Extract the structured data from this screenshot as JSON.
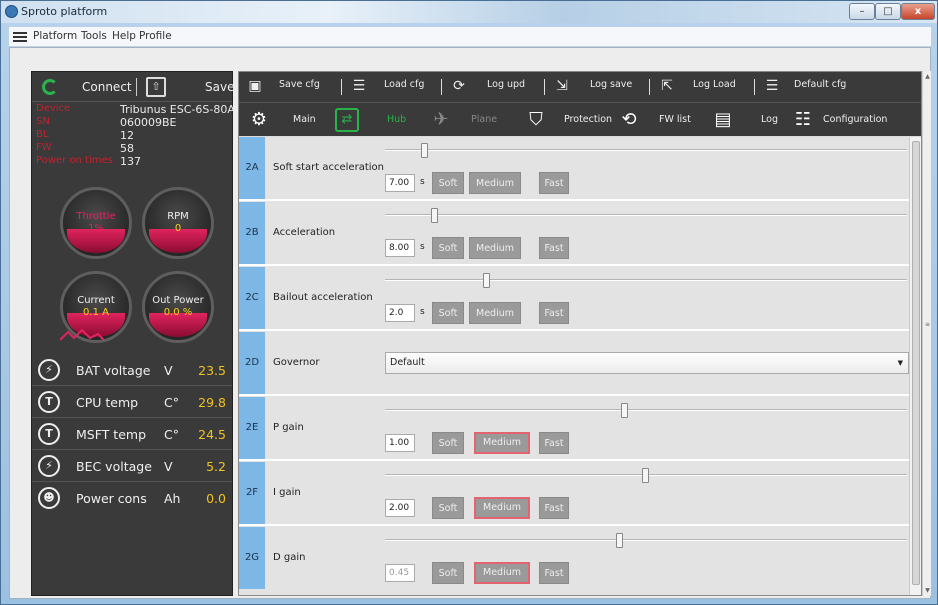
{
  "window": {
    "title": "Sproto platform",
    "controls": {
      "min": "–",
      "max": "□",
      "close": "x"
    }
  },
  "menu": [
    "Platform",
    "Tools",
    "Help",
    "Profile"
  ],
  "left_panel": {
    "connect_label": "Connect",
    "save_label": "Save",
    "info": [
      {
        "key": "Device",
        "value": "Tribunus ESC-6S-80A"
      },
      {
        "key": "SN",
        "value": "060009BE"
      },
      {
        "key": "BL",
        "value": "12"
      },
      {
        "key": "FW",
        "value": "58"
      },
      {
        "key": "Power on times",
        "value": "137"
      }
    ],
    "gauges": {
      "throttle": {
        "name": "Throttle",
        "value": "1%"
      },
      "rpm": {
        "name": "RPM",
        "value": "0"
      },
      "current": {
        "name": "Current",
        "value": "0.1 A"
      },
      "out_power": {
        "name": "Out Power",
        "value": "0.0 %"
      }
    },
    "stats": [
      {
        "icon": "bat-voltage-icon",
        "symbol": "⚡",
        "label": "BAT voltage",
        "unit": "V",
        "value": "23.5"
      },
      {
        "icon": "cpu-temp-icon",
        "symbol": "T",
        "label": "CPU temp",
        "unit": "C°",
        "value": "29.8"
      },
      {
        "icon": "msft-temp-icon",
        "symbol": "T",
        "label": "MSFT temp",
        "unit": "C°",
        "value": "24.5"
      },
      {
        "icon": "bec-voltage-icon",
        "symbol": "⚡",
        "label": "BEC voltage",
        "unit": "V",
        "value": "5.2"
      },
      {
        "icon": "power-cons-icon",
        "symbol": "☻",
        "label": "Power cons",
        "unit": "Ah",
        "value": "0.0"
      }
    ]
  },
  "toolbar": {
    "save_cfg": "Save cfg",
    "load_cfg": "Load cfg",
    "log_upd": "Log upd",
    "log_save": "Log save",
    "log_load": "Log Load",
    "default_cfg": "Default cfg"
  },
  "tabs": {
    "main": "Main",
    "hub": "Hub",
    "plane": "Plane",
    "protection": "Protection",
    "fw_list": "FW list",
    "log": "Log",
    "configuration": "Configuration"
  },
  "params": [
    {
      "id": "2A",
      "name": "Soft start acceleration",
      "value": "7.00",
      "unit": "s",
      "slider": 0.07,
      "selected": null
    },
    {
      "id": "2B",
      "name": "Acceleration",
      "value": "8.00",
      "unit": "s",
      "slider": 0.09,
      "selected": null
    },
    {
      "id": "2C",
      "name": "Bailout acceleration",
      "value": "2.0",
      "unit": "s",
      "slider": 0.19,
      "selected": null
    },
    {
      "id": "2D",
      "name": "Governor",
      "dropdown": "Default"
    },
    {
      "id": "2E",
      "name": "P gain",
      "value": "1.00",
      "unit": "",
      "slider": 0.46,
      "selected": "medium"
    },
    {
      "id": "2F",
      "name": "I gain",
      "value": "2.00",
      "unit": "",
      "slider": 0.5,
      "selected": "medium"
    },
    {
      "id": "2G",
      "name": "D gain",
      "value": "0.45",
      "unit": "",
      "slider": 0.45,
      "selected": "medium"
    }
  ],
  "presets": {
    "soft": "Soft",
    "medium": "Medium",
    "fast": "Fast"
  }
}
